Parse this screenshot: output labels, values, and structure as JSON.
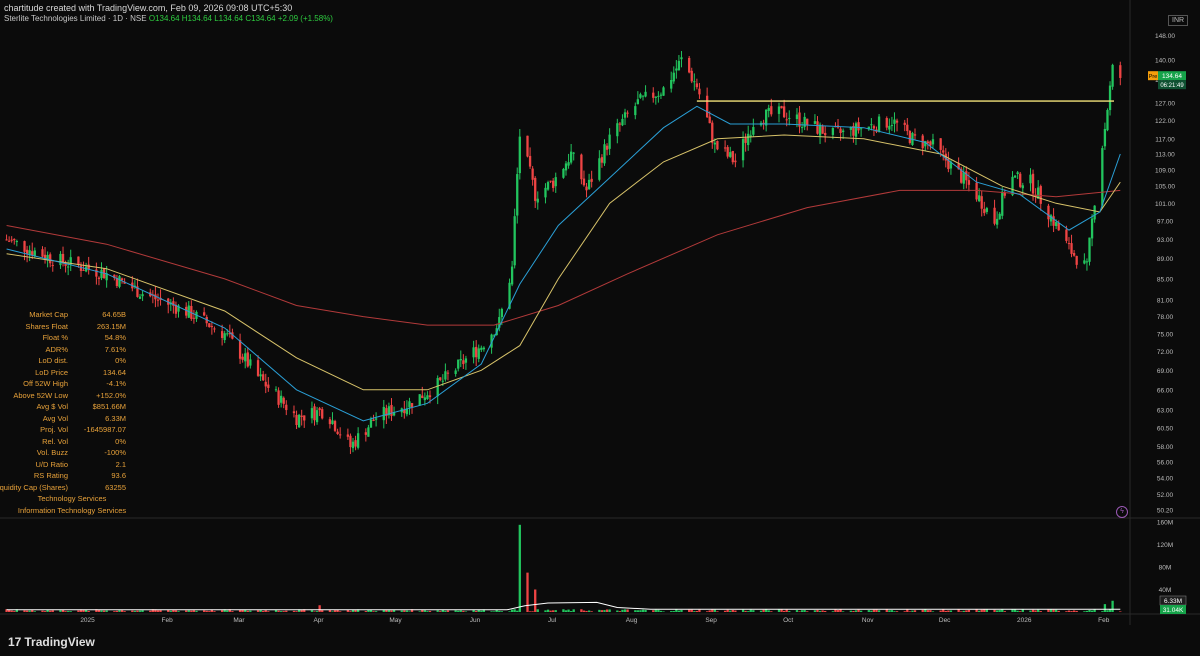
{
  "header": {
    "credit": "chartitude created with TradingView.com, Feb 09, 2026 09:08 UTC+5:30",
    "symbol": "Sterlite Technologies Limited · 1D · NSE",
    "quote": "O134.64 H134.64 L134.64 C134.64 +2.09 (+1.58%)"
  },
  "currency_label": "INR",
  "price_tags": {
    "pre_label": "Pre",
    "price": "134.64",
    "countdown": "06:21:49"
  },
  "volume_tags": {
    "avg": "6.33M",
    "last": "31.04K"
  },
  "brand": {
    "logo_text": "TradingView",
    "logo_mark": "17"
  },
  "plugin_icon": "lightning-icon",
  "stats": [
    {
      "key": "Market Cap",
      "value": "64.65B"
    },
    {
      "key": "Shares Float",
      "value": "263.15M"
    },
    {
      "key": "Float %",
      "value": "54.8%"
    },
    {
      "key": "ADR%",
      "value": "7.61%"
    },
    {
      "key": "LoD dist.",
      "value": "0%"
    },
    {
      "key": "LoD Price",
      "value": "134.64"
    },
    {
      "key": "Off 52W High",
      "value": "-4.1%"
    },
    {
      "key": "Above 52W Low",
      "value": "+152.0%"
    },
    {
      "key": "Avg $ Vol",
      "value": "$851.66M"
    },
    {
      "key": "Avg Vol",
      "value": "6.33M"
    },
    {
      "key": "Proj. Vol",
      "value": "-1645987.07"
    },
    {
      "key": "Rel. Vol",
      "value": "0%"
    },
    {
      "key": "Vol. Buzz",
      "value": "-100%"
    },
    {
      "key": "U/D Ratio",
      "value": "2.1"
    },
    {
      "key": "RS Rating",
      "value": "93.6"
    },
    {
      "key": "Liquidity Cap (Shares)",
      "value": "63255"
    }
  ],
  "sector": "Technology Services",
  "industry": "Information Technology Services",
  "colors": {
    "up": "#22c55e",
    "down": "#ef4444",
    "ema_fast": "#2a9fd6",
    "ema_mid": "#d8c36a",
    "ema_slow": "#b23a3a",
    "resistance": "#f2e27a",
    "vol_avg": "#ffffff",
    "tag_green": "#16a34a",
    "tag_orange": "#f59e0b"
  },
  "chart_data": {
    "type": "candlestick",
    "price_axis": {
      "scale": "log",
      "ticks": [
        "148.00",
        "140.00",
        "134.00",
        "127.00",
        "122.00",
        "117.00",
        "113.00",
        "109.00",
        "105.00",
        "101.00",
        "97.00",
        "93.00",
        "89.00",
        "85.00",
        "81.00",
        "78.00",
        "75.00",
        "72.00",
        "69.00",
        "66.00",
        "63.00",
        "60.50",
        "58.00",
        "56.00",
        "54.00",
        "52.00",
        "50.20"
      ],
      "range": [
        49.5,
        152
      ]
    },
    "time_axis": {
      "labels": [
        "2025",
        "Feb",
        "Mar",
        "Apr",
        "May",
        "Jun",
        "Jul",
        "Aug",
        "Sep",
        "Oct",
        "Nov",
        "Dec",
        "2026",
        "Feb"
      ]
    },
    "resistance_level": 127.5,
    "price_path": [
      [
        "2024-12-02",
        93
      ],
      [
        "2024-12-20",
        89
      ],
      [
        "2025-01-10",
        86
      ],
      [
        "2025-01-25",
        82
      ],
      [
        "2025-02-10",
        79
      ],
      [
        "2025-02-25",
        75
      ],
      [
        "2025-03-10",
        68
      ],
      [
        "2025-03-25",
        62
      ],
      [
        "2025-04-05",
        63
      ],
      [
        "2025-04-15",
        58
      ],
      [
        "2025-04-25",
        62
      ],
      [
        "2025-05-08",
        64
      ],
      [
        "2025-05-20",
        67
      ],
      [
        "2025-05-28",
        70
      ],
      [
        "2025-06-05",
        73
      ],
      [
        "2025-06-12",
        77
      ],
      [
        "2025-06-17",
        87
      ],
      [
        "2025-06-20",
        118
      ],
      [
        "2025-06-26",
        103
      ],
      [
        "2025-07-03",
        106
      ],
      [
        "2025-07-10",
        113
      ],
      [
        "2025-07-16",
        104
      ],
      [
        "2025-07-25",
        117
      ],
      [
        "2025-08-05",
        127
      ],
      [
        "2025-08-15",
        131
      ],
      [
        "2025-08-22",
        140
      ],
      [
        "2025-08-28",
        132
      ],
      [
        "2025-09-04",
        115
      ],
      [
        "2025-09-12",
        111
      ],
      [
        "2025-09-20",
        123
      ],
      [
        "2025-10-01",
        124
      ],
      [
        "2025-10-10",
        121
      ],
      [
        "2025-10-20",
        118
      ],
      [
        "2025-11-01",
        120
      ],
      [
        "2025-11-12",
        122
      ],
      [
        "2025-11-20",
        117
      ],
      [
        "2025-11-28",
        115
      ],
      [
        "2025-12-08",
        108
      ],
      [
        "2025-12-15",
        103
      ],
      [
        "2025-12-22",
        97
      ],
      [
        "2025-12-28",
        107
      ],
      [
        "2026-01-05",
        106
      ],
      [
        "2026-01-12",
        99
      ],
      [
        "2026-01-20",
        91
      ],
      [
        "2026-01-27",
        87
      ],
      [
        "2026-01-30",
        102
      ],
      [
        "2026-02-03",
        120
      ],
      [
        "2026-02-06",
        137
      ],
      [
        "2026-02-09",
        134.64
      ]
    ],
    "ema_fast": [
      [
        "2024-12-02",
        91
      ],
      [
        "2025-01-10",
        86
      ],
      [
        "2025-02-25",
        76
      ],
      [
        "2025-03-25",
        66
      ],
      [
        "2025-04-20",
        61.5
      ],
      [
        "2025-05-15",
        64
      ],
      [
        "2025-06-05",
        70
      ],
      [
        "2025-06-20",
        84
      ],
      [
        "2025-07-05",
        96
      ],
      [
        "2025-07-25",
        107
      ],
      [
        "2025-08-15",
        120
      ],
      [
        "2025-08-28",
        126
      ],
      [
        "2025-09-10",
        121
      ],
      [
        "2025-10-01",
        121
      ],
      [
        "2025-11-01",
        120
      ],
      [
        "2025-11-25",
        116
      ],
      [
        "2025-12-15",
        106
      ],
      [
        "2026-01-01",
        103
      ],
      [
        "2026-01-20",
        95
      ],
      [
        "2026-02-01",
        99
      ],
      [
        "2026-02-09",
        113
      ]
    ],
    "ema_mid": [
      [
        "2024-12-02",
        90
      ],
      [
        "2025-01-10",
        87
      ],
      [
        "2025-02-25",
        79
      ],
      [
        "2025-03-25",
        71
      ],
      [
        "2025-04-20",
        66
      ],
      [
        "2025-05-15",
        66
      ],
      [
        "2025-06-05",
        69
      ],
      [
        "2025-06-20",
        73
      ],
      [
        "2025-07-05",
        85
      ],
      [
        "2025-07-25",
        101
      ],
      [
        "2025-08-15",
        111
      ],
      [
        "2025-09-05",
        117
      ],
      [
        "2025-10-01",
        118
      ],
      [
        "2025-11-01",
        117
      ],
      [
        "2025-12-01",
        113
      ],
      [
        "2025-12-25",
        105
      ],
      [
        "2026-01-15",
        101
      ],
      [
        "2026-02-01",
        99
      ],
      [
        "2026-02-09",
        106
      ]
    ],
    "ema_slow": [
      [
        "2024-12-02",
        96
      ],
      [
        "2025-01-10",
        92
      ],
      [
        "2025-02-25",
        85
      ],
      [
        "2025-03-25",
        80
      ],
      [
        "2025-04-20",
        78
      ],
      [
        "2025-05-15",
        76.5
      ],
      [
        "2025-06-10",
        76.5
      ],
      [
        "2025-07-05",
        80
      ],
      [
        "2025-08-01",
        86
      ],
      [
        "2025-09-05",
        94
      ],
      [
        "2025-10-10",
        100
      ],
      [
        "2025-11-15",
        104
      ],
      [
        "2025-12-15",
        104
      ],
      [
        "2026-01-15",
        102.5
      ],
      [
        "2026-02-09",
        104
      ]
    ],
    "volume_axis": {
      "ticks": [
        "160M",
        "120M",
        "80M",
        "40M"
      ],
      "max": 160
    },
    "volume_spikes_m": [
      [
        "2025-06-20",
        155
      ],
      [
        "2025-06-23",
        70
      ],
      [
        "2025-06-26",
        40
      ],
      [
        "2025-04-03",
        12
      ],
      [
        "2025-07-20",
        14
      ],
      [
        "2025-12-28",
        10
      ],
      [
        "2026-02-03",
        14
      ],
      [
        "2026-02-06",
        20
      ]
    ]
  }
}
